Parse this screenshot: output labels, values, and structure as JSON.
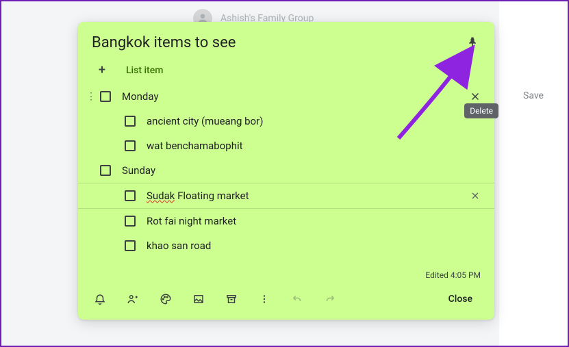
{
  "background": {
    "group_label": "Ashish's Family Group",
    "save_label": "Save"
  },
  "note": {
    "title": "Bangkok items to see",
    "add_item_label": "List item",
    "edited_label": "Edited 4:05 PM",
    "close_label": "Close",
    "delete_tooltip": "Delete",
    "items": [
      {
        "text": "Monday",
        "sub": false,
        "focused": true
      },
      {
        "text": "ancient city (mueang bor)",
        "sub": true
      },
      {
        "text": "wat benchamabophit",
        "sub": true
      },
      {
        "text": "Sunday",
        "sub": false
      },
      {
        "text_parts": [
          "Sudak",
          " Floating market"
        ],
        "sub": true,
        "active": true,
        "border_top": true,
        "border_bottom": true,
        "spellerr": true
      },
      {
        "text": "Rot fai night market",
        "sub": true
      },
      {
        "text": "khao san road",
        "sub": true
      }
    ]
  }
}
